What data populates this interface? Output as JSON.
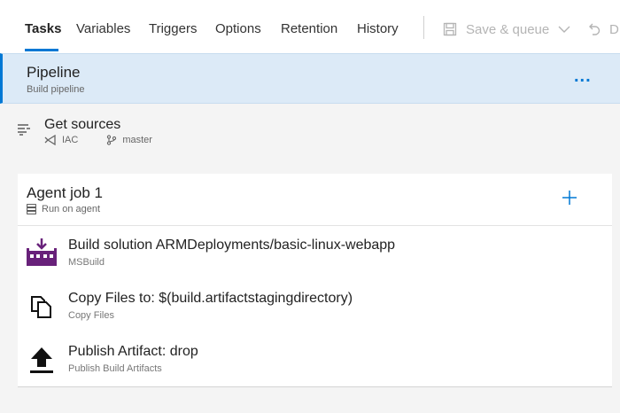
{
  "tabs": [
    {
      "label": "Tasks",
      "active": true
    },
    {
      "label": "Variables"
    },
    {
      "label": "Triggers"
    },
    {
      "label": "Options"
    },
    {
      "label": "Retention"
    },
    {
      "label": "History"
    }
  ],
  "toolbar": {
    "save_queue_label": "Save & queue",
    "undo_label": "D",
    "disabled_color": "#b4b4b4"
  },
  "pipeline": {
    "title": "Pipeline",
    "subtitle": "Build pipeline",
    "more_label": "...",
    "accent": "#0078d4",
    "bg": "#dceaf7"
  },
  "sources": {
    "title": "Get sources",
    "repo": "IAC",
    "branch": "master",
    "icon": "list-icon"
  },
  "job": {
    "title": "Agent job 1",
    "subtitle": "Run on agent",
    "add_icon": "plus-icon"
  },
  "tasks": [
    {
      "title": "Build solution ARMDeployments/basic-linux-webapp",
      "subtitle": "MSBuild",
      "icon": "msbuild-icon",
      "icon_color": "#68217a"
    },
    {
      "title": "Copy Files to: $(build.artifactstagingdirectory)",
      "subtitle": "Copy Files",
      "icon": "copy-files-icon"
    },
    {
      "title": "Publish Artifact: drop",
      "subtitle": "Publish Build Artifacts",
      "icon": "upload-icon"
    }
  ]
}
